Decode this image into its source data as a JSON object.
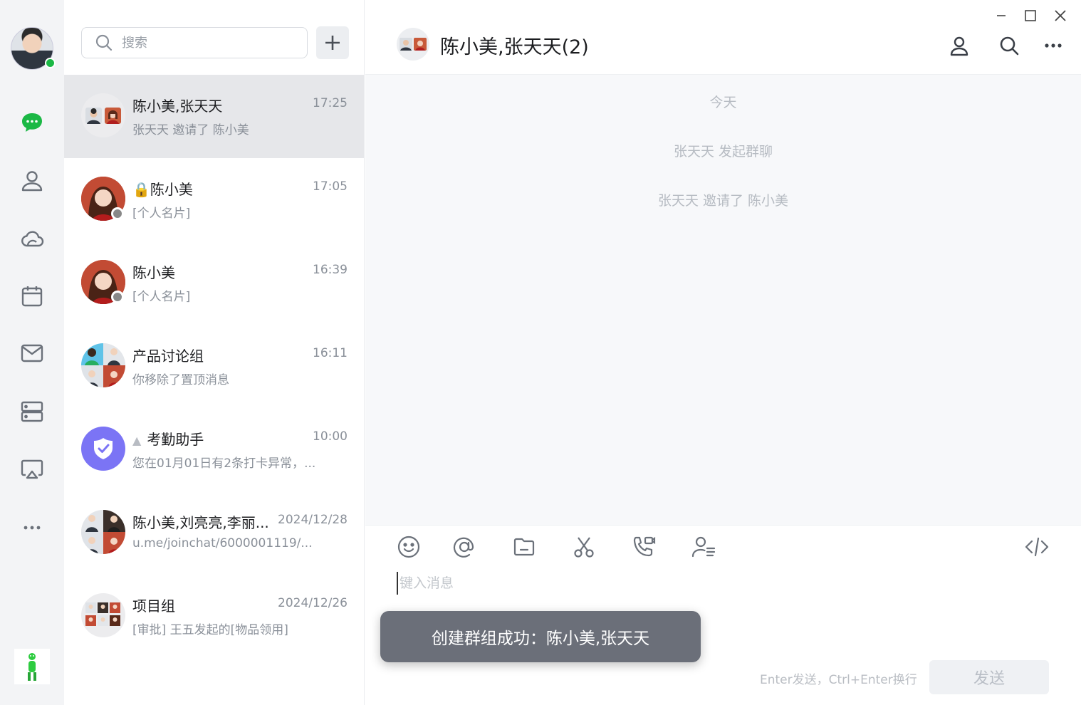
{
  "rail": {
    "items": [
      {
        "name": "chat",
        "icon": "chat-bubble-icon",
        "active": true
      },
      {
        "name": "contacts",
        "icon": "person-icon"
      },
      {
        "name": "cloud",
        "icon": "cloud-icon"
      },
      {
        "name": "calendar",
        "icon": "calendar-icon"
      },
      {
        "name": "mail",
        "icon": "mail-icon"
      },
      {
        "name": "storage",
        "icon": "server-icon"
      },
      {
        "name": "screen-share",
        "icon": "airplay-icon"
      },
      {
        "name": "more",
        "icon": "more-dots-icon"
      }
    ],
    "accent_color": "#1bb845"
  },
  "search": {
    "placeholder": "搜索"
  },
  "conversations": [
    {
      "name": "陈小美,张天天",
      "time": "17:25",
      "preview": "张天天 邀请了 陈小美",
      "active": true
    },
    {
      "name": "陈小美",
      "time": "17:05",
      "preview": "[个人名片]",
      "locked": true
    },
    {
      "name": "陈小美",
      "time": "16:39",
      "preview": "[个人名片]"
    },
    {
      "name": "产品讨论组",
      "time": "16:11",
      "preview": "你移除了置顶消息"
    },
    {
      "name": "考勤助手",
      "time": "10:00",
      "preview": "您在01月01日有2条打卡异常，..."
    },
    {
      "name": "陈小美,刘亮亮,李丽...",
      "time": "2024/12/28",
      "preview": "u.me/joinchat/6000001119/..."
    },
    {
      "name": "项目组",
      "time": "2024/12/26",
      "preview": "[审批] 王五发起的[物品领用]"
    }
  ],
  "chat": {
    "title": "陈小美,张天天(2)",
    "system_messages": [
      "今天",
      "张天天 发起群聊",
      "张天天 邀请了 陈小美"
    ],
    "input_placeholder": "键入消息",
    "hint": "Enter发送，Ctrl+Enter换行",
    "send_label": "发送"
  },
  "toast": {
    "text": "创建群组成功：陈小美,张天天"
  }
}
